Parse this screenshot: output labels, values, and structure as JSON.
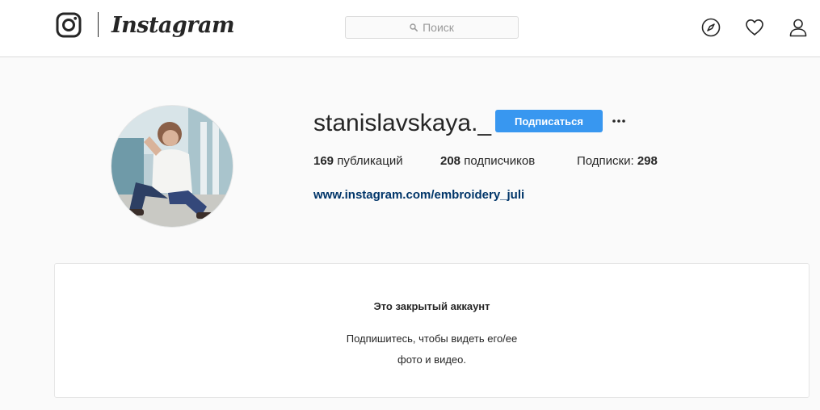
{
  "header": {
    "brand": "Instagram",
    "search_placeholder": "Поиск",
    "icons": [
      "instagram-logo-icon",
      "explore-compass-icon",
      "activity-heart-icon",
      "profile-person-icon",
      "search-icon"
    ]
  },
  "profile": {
    "username": "stanislavskaya._",
    "follow_label": "Подписаться",
    "more_label": "···",
    "stats": {
      "posts_count": "169",
      "posts_label": "публикаций",
      "followers_count": "208",
      "followers_label": "подписчиков",
      "following_label": "Подписки:",
      "following_count": "298"
    },
    "website": "www.instagram.com/embroidery_juli"
  },
  "private_notice": {
    "title": "Это закрытый аккаунт",
    "line1": "Подпишитесь, чтобы видеть его/ее",
    "line2": "фото и видео."
  },
  "colors": {
    "accent": "#3897f0",
    "link": "#003569",
    "background": "#fafafa",
    "border": "#dbdbdb"
  }
}
